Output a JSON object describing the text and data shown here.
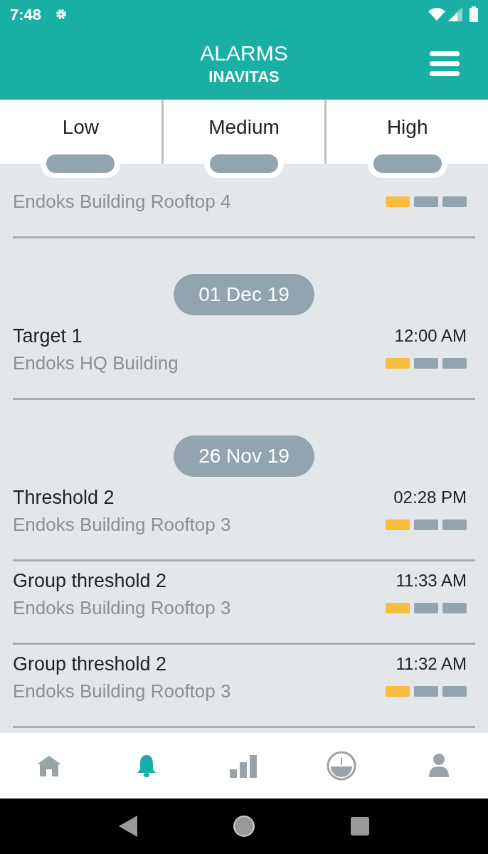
{
  "status_bar": {
    "time": "7:48"
  },
  "header": {
    "title": "ALARMS",
    "subtitle": "INAVITAS"
  },
  "tabs": [
    {
      "label": "Low",
      "selected": false
    },
    {
      "label": "Medium",
      "selected": false
    },
    {
      "label": "High",
      "selected": false
    }
  ],
  "groups": [
    {
      "items": [
        {
          "location": "Endoks Building Rooftop 4",
          "level": 0.33
        }
      ]
    },
    {
      "date": "01 Dec 19",
      "items": [
        {
          "name": "Target 1",
          "time": "12:00 AM",
          "location": "Endoks HQ Building",
          "level": 0.33
        }
      ]
    },
    {
      "date": "26 Nov 19",
      "items": [
        {
          "name": "Threshold 2",
          "time": "02:28 PM",
          "location": "Endoks Building Rooftop 3",
          "level": 0.33
        },
        {
          "name": "Group threshold 2",
          "time": "11:33 AM",
          "location": "Endoks Building Rooftop 3",
          "level": 0.33
        },
        {
          "name": "Group threshold 2",
          "time": "11:32 AM",
          "location": "Endoks Building Rooftop 3",
          "level": 0.33
        }
      ]
    }
  ],
  "bottom_nav": [
    {
      "kind": "home",
      "selected": false
    },
    {
      "kind": "bell",
      "selected": true
    },
    {
      "kind": "chart",
      "selected": false
    },
    {
      "kind": "gauge",
      "selected": false
    },
    {
      "kind": "user",
      "selected": false
    }
  ]
}
